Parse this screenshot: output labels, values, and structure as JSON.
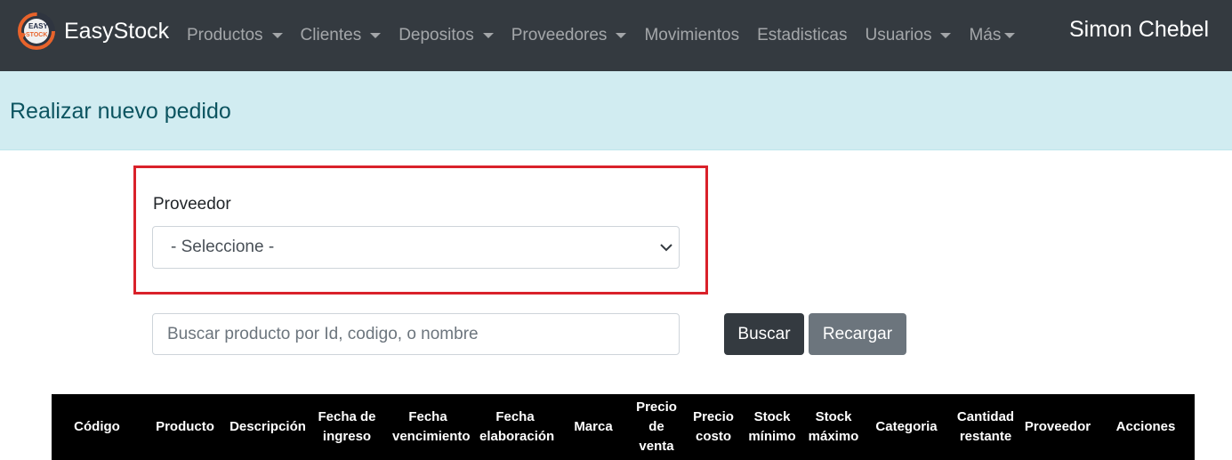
{
  "navbar": {
    "brand": "EasyStock",
    "logo_text_top": "EASY",
    "logo_text_bottom": "STOCK",
    "items": [
      {
        "label": "Productos",
        "dropdown": true
      },
      {
        "label": "Clientes",
        "dropdown": true
      },
      {
        "label": "Depositos",
        "dropdown": true
      },
      {
        "label": "Proveedores",
        "dropdown": true
      },
      {
        "label": "Movimientos",
        "dropdown": false
      },
      {
        "label": "Estadisticas",
        "dropdown": false
      },
      {
        "label": "Usuarios",
        "dropdown": true
      },
      {
        "label": "Más",
        "dropdown": true
      }
    ],
    "user": "Simon Chebel"
  },
  "header": {
    "title": "Realizar nuevo pedido"
  },
  "form": {
    "proveedor_label": "Proveedor",
    "proveedor_selected": "- Seleccione -",
    "search_placeholder": "Buscar producto por Id, codigo, o nombre",
    "buscar_label": "Buscar",
    "recargar_label": "Recargar"
  },
  "table": {
    "columns": [
      "Código",
      "Producto",
      "Descripción",
      "Fecha de ingreso",
      "Fecha vencimiento",
      "Fecha elaboración",
      "Marca",
      "Precio de venta",
      "Precio costo",
      "Stock mínimo",
      "Stock máximo",
      "Categoria",
      "Cantidad restante",
      "Proveedor",
      "Acciones"
    ]
  },
  "colors": {
    "navbar": "#343a40",
    "header_band": "#d1ecf1",
    "header_text": "#0c5460",
    "highlight": "#d9212a",
    "btn_dark": "#343a40",
    "btn_secondary": "#6c757d",
    "table_head": "#000000"
  }
}
